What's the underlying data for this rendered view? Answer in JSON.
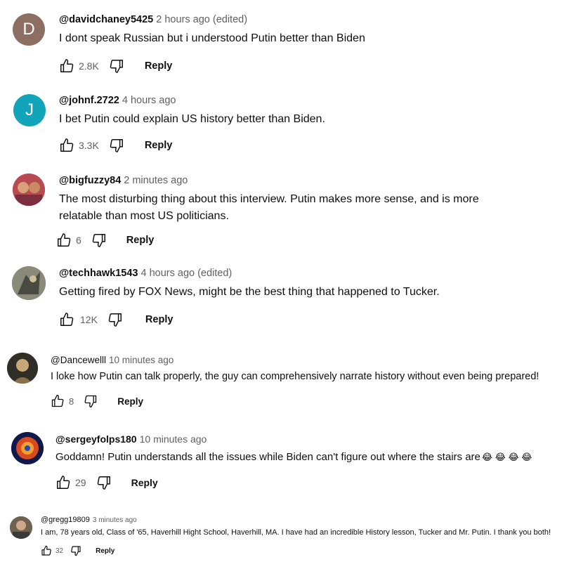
{
  "comments": [
    {
      "author": "@davidchaney5425",
      "time": "2 hours ago (edited)",
      "text": "I dont speak Russian but i understood Putin better than Biden",
      "likes": "2.8K",
      "reply": "Reply",
      "avatar_letter": "D",
      "avatar_color": "#8d6e63"
    },
    {
      "author": "@johnf.2722",
      "time": "4 hours ago",
      "text": "I bet Putin could explain US history better than Biden.",
      "likes": "3.3K",
      "reply": "Reply",
      "avatar_letter": "J",
      "avatar_color": "#12a4b8"
    },
    {
      "author": "@bigfuzzy84",
      "time": "2 minutes ago",
      "text": "The most disturbing thing about this interview. Putin makes more sense, and is more relatable than most US politicians.",
      "likes": "6",
      "reply": "Reply",
      "avatar_color": "#c0564e"
    },
    {
      "author": "@techhawk1543",
      "time": "4 hours ago (edited)",
      "text": "Getting fired by FOX News, might be the best thing that happened to Tucker.",
      "likes": "12K",
      "reply": "Reply",
      "avatar_color": "#6b6b5e"
    },
    {
      "author": "@Dancewelll",
      "time": "10 minutes ago",
      "text": "I loke how Putin can talk properly, the guy can comprehensively narrate history without even being prepared!",
      "likes": "8",
      "reply": "Reply",
      "avatar_color": "#3a3a30"
    },
    {
      "author": "@sergeyfolps180",
      "time": "10 minutes ago",
      "text": "Goddamn! Putin understands all the issues while Biden can't figure out where the stairs are",
      "emojis": "😂 😂 😂 😂",
      "likes": "29",
      "reply": "Reply",
      "avatar_color": "#1a2a6e"
    },
    {
      "author": "@gregg19809",
      "time": "3 minutes ago",
      "text": "I am, 78 years old, Class of '65, Haverhill Hight School, Haverhill, MA. I have had an incredible History lesson, Tucker and Mr. Putin. I thank you both!",
      "likes": "32",
      "reply": "Reply",
      "avatar_color": "#7a6a55"
    }
  ]
}
